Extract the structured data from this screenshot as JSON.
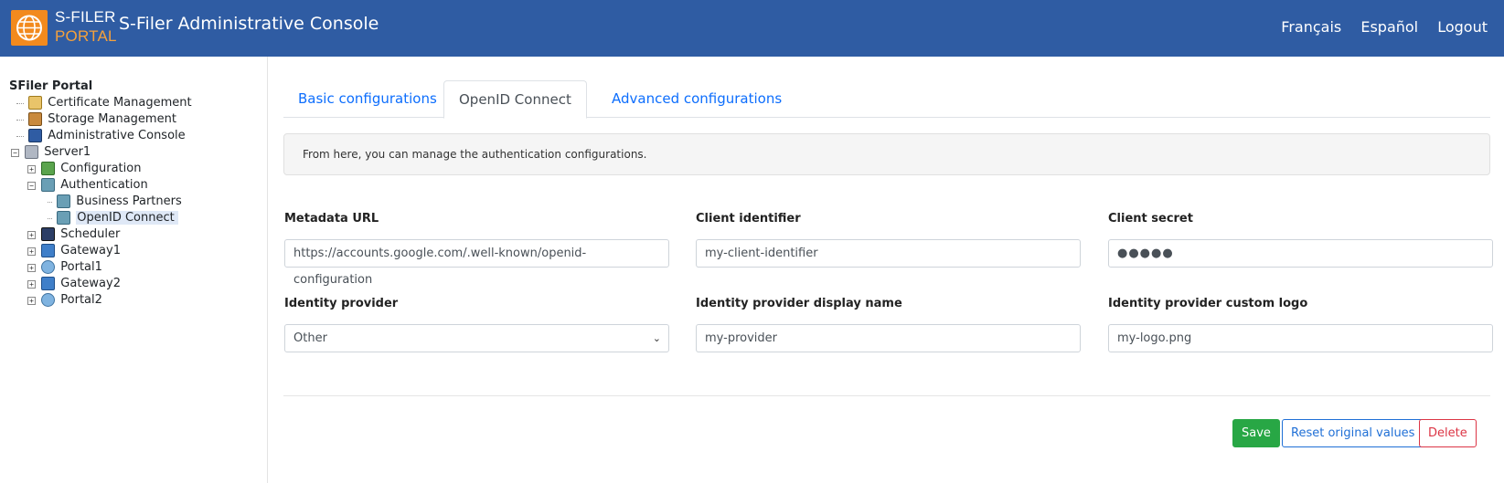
{
  "header": {
    "logo_line1": "S-FILER",
    "logo_line2": "PORTAL",
    "title": "S-Filer Administrative Console",
    "links": [
      "Français",
      "Español",
      "Logout"
    ]
  },
  "colors": {
    "header_bg": "#2f5ca3",
    "logo_orange": "#f28a1e",
    "link_blue": "#0d6efd",
    "save_green": "#28a745",
    "delete_red": "#dc3545"
  },
  "tree": {
    "root": "SFiler Portal",
    "nodes": [
      {
        "label": "Certificate Management",
        "icon": "certificate-icon"
      },
      {
        "label": "Storage Management",
        "icon": "storage-box-icon"
      },
      {
        "label": "Administrative Console",
        "icon": "console-gear-icon"
      },
      {
        "label": "Server1",
        "icon": "server-icon",
        "toggle": "−"
      },
      {
        "label": "Configuration",
        "icon": "configuration-checklist-icon",
        "toggle": "+"
      },
      {
        "label": "Authentication",
        "icon": "users-icon",
        "toggle": "−"
      },
      {
        "label": "Business Partners",
        "icon": "users-icon"
      },
      {
        "label": "OpenID Connect",
        "icon": "users-icon",
        "selected": true
      },
      {
        "label": "Scheduler",
        "icon": "clock-icon",
        "toggle": "+"
      },
      {
        "label": "Gateway1",
        "icon": "gateway-network-icon",
        "toggle": "+"
      },
      {
        "label": "Portal1",
        "icon": "portal-globe-icon",
        "toggle": "+"
      },
      {
        "label": "Gateway2",
        "icon": "gateway-network-icon",
        "toggle": "+"
      },
      {
        "label": "Portal2",
        "icon": "portal-globe-icon",
        "toggle": "+"
      }
    ]
  },
  "tabs": [
    "Basic configurations",
    "OpenID Connect",
    "Advanced configurations"
  ],
  "active_tab": "OpenID Connect",
  "info_text": "From here, you can manage the authentication configurations.",
  "form": {
    "metadata_url": {
      "label": "Metadata URL",
      "value": "https://accounts.google.com/.well-known/openid-configuration"
    },
    "client_identifier": {
      "label": "Client identifier",
      "value": "my-client-identifier"
    },
    "client_secret": {
      "label": "Client secret",
      "value": "●●●●●"
    },
    "identity_provider": {
      "label": "Identity provider",
      "value": "Other"
    },
    "idp_display_name": {
      "label": "Identity provider display name",
      "value": "my-provider"
    },
    "idp_custom_logo": {
      "label": "Identity provider custom logo",
      "value": "my-logo.png"
    }
  },
  "buttons": {
    "save": "Save",
    "reset": "Reset original values",
    "delete": "Delete"
  }
}
